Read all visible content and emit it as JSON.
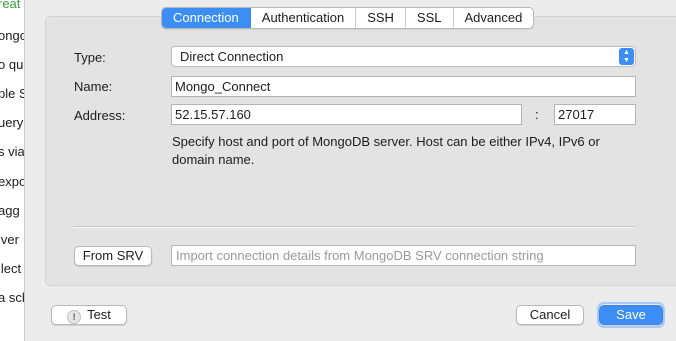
{
  "background_fragments": [
    "reat",
    "ongo",
    "o qu",
    "ple S",
    "uery",
    "s via",
    "expo",
    "agg",
    "iver",
    "llect",
    "a sch"
  ],
  "tabs": [
    "Connection",
    "Authentication",
    "SSH",
    "SSL",
    "Advanced"
  ],
  "active_tab": "Connection",
  "form": {
    "type_label": "Type:",
    "type_value": "Direct Connection",
    "name_label": "Name:",
    "name_value": "Mongo_Connect",
    "address_label": "Address:",
    "host_value": "52.15.57.160",
    "separator": ":",
    "port_value": "27017",
    "hint": "Specify host and port of MongoDB server. Host can be either IPv4, IPv6 or domain name."
  },
  "srv": {
    "button_label": "From SRV",
    "placeholder": "Import connection details from MongoDB SRV connection string"
  },
  "footer": {
    "test_label": "Test",
    "cancel_label": "Cancel",
    "save_label": "Save"
  },
  "colors": {
    "accent": "#3c8ef5",
    "green_text": "#3a9b3a"
  }
}
